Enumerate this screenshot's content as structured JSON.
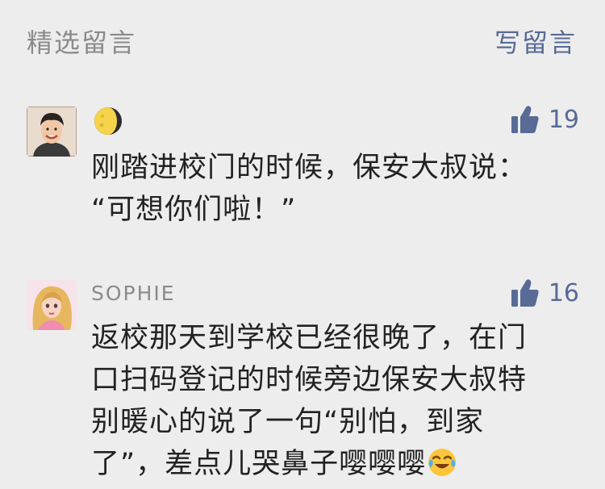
{
  "header": {
    "section_title": "精选留言",
    "write_label": "写留言"
  },
  "comments": [
    {
      "nickname": "",
      "nickname_icon": "crescent-moon-emoji",
      "avatar_icon": "smiling-young-man-photo",
      "likes": "19",
      "lines": [
        "刚踏进校门的时候，保安大叔说：",
        "“可想你们啦！”"
      ]
    },
    {
      "nickname": "SOPHIE",
      "avatar_icon": "cartoon-blonde-girl-illustration",
      "likes": "16",
      "lines": [
        "返校那天到学校已经很晚了，在门",
        "口扫码登记的时候旁边保安大叔特",
        "别暖心的说了一句“别怕，到家",
        "了”，差点儿哭鼻子嘤嘤嘤"
      ],
      "trailing_emoji": "crying-laughing-emoji"
    }
  ],
  "colors": {
    "background": "#ededed",
    "link": "#576b95",
    "muted": "#8a8a8a",
    "text": "#222222"
  }
}
